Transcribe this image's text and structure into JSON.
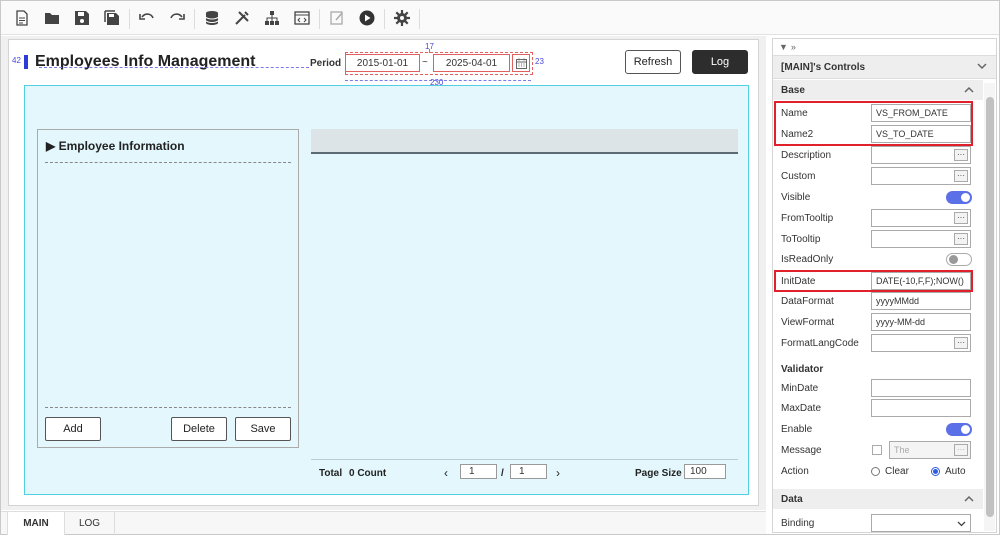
{
  "toolbar": {
    "icons": [
      "new-file-icon",
      "open-folder-icon",
      "save-icon",
      "save-all-icon",
      "undo-icon",
      "redo-icon",
      "database-icon",
      "tools-icon",
      "hierarchy-icon",
      "code-icon",
      "edit-icon",
      "run-icon",
      "settings-icon"
    ]
  },
  "canvas": {
    "title": "Employees Info Management",
    "period_label": "Period",
    "from_date": "2015-01-01",
    "tilde": "~",
    "to_date": "2025-04-01",
    "refresh_label": "Refresh",
    "log_label": "Log",
    "dim_top": "17",
    "dim_left": "42",
    "dim_right": "23",
    "dim_bottom": "230"
  },
  "employee_panel": {
    "title": "▶ Employee Information",
    "add_label": "Add",
    "delete_label": "Delete",
    "save_label": "Save"
  },
  "grid": {
    "total_label": "Total",
    "count_text": "0 Count",
    "page_current": "1",
    "page_sep": "/",
    "page_total": "1",
    "page_size_label": "Page Size",
    "page_size": "100"
  },
  "tabs": [
    "MAIN",
    "LOG"
  ],
  "props": {
    "header": "[MAIN]'s Controls",
    "base_section": "Base",
    "rows": [
      {
        "label": "Name",
        "value": "VS_FROM_DATE"
      },
      {
        "label": "Name2",
        "value": "VS_TO_DATE"
      },
      {
        "label": "Description",
        "value": ""
      },
      {
        "label": "Custom",
        "value": ""
      },
      {
        "label": "Visible",
        "value": ""
      },
      {
        "label": "FromTooltip",
        "value": ""
      },
      {
        "label": "ToTooltip",
        "value": ""
      },
      {
        "label": "IsReadOnly",
        "value": ""
      },
      {
        "label": "InitDate",
        "value": "DATE(-10,F,F);NOW()"
      },
      {
        "label": "DataFormat",
        "value": "yyyyMMdd"
      },
      {
        "label": "ViewFormat",
        "value": "yyyy-MM-dd"
      },
      {
        "label": "FormatLangCode",
        "value": ""
      }
    ],
    "validator_section": "Validator",
    "validator_rows": [
      {
        "label": "MinDate",
        "value": ""
      },
      {
        "label": "MaxDate",
        "value": ""
      },
      {
        "label": "Enable",
        "value": ""
      },
      {
        "label": "Message",
        "value": "The"
      },
      {
        "label": "Action",
        "value": ""
      }
    ],
    "action_clear": "Clear",
    "action_auto": "Auto",
    "data_section": "Data",
    "binding_label": "Binding",
    "binding_value": ""
  },
  "colors": {
    "accent_blue": "#5b6fe6",
    "highlight_red": "#e0202a",
    "canvas_cyan": "#e3f7fc"
  }
}
